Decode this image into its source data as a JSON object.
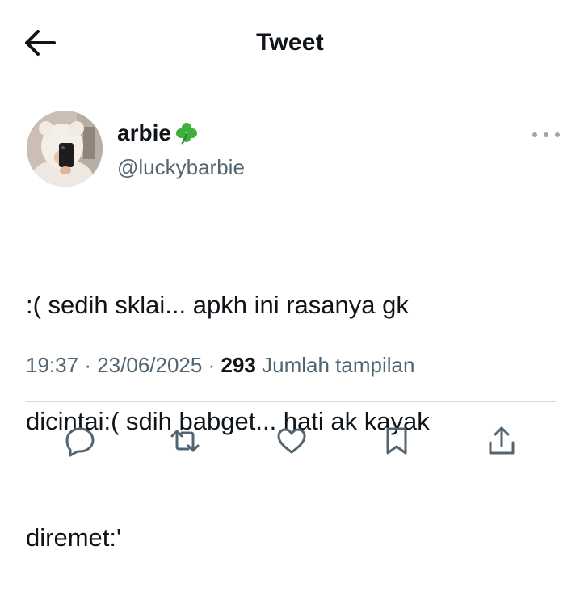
{
  "header": {
    "title": "Tweet",
    "back_icon": "arrow-left-icon"
  },
  "author": {
    "display_name": "arbie",
    "emoji": "🍀",
    "handle": "@luckybarbie",
    "avatar_icon": "avatar-photo",
    "more_icon": "more-horizontal-icon"
  },
  "tweet": {
    "lines": [
      ":( sedih sklai... apkh ini rasanya gk",
      "dicintai:( sdih babget... hati ak kayak",
      "diremet:'"
    ],
    "time": "19:37",
    "sep1": "·",
    "date": "23/06/2025",
    "sep2": "·",
    "views_count": "293",
    "views_label": "Jumlah tampilan"
  },
  "actions": [
    {
      "icon": "reply-icon"
    },
    {
      "icon": "retweet-icon"
    },
    {
      "icon": "like-icon"
    },
    {
      "icon": "bookmark-icon"
    },
    {
      "icon": "share-icon"
    }
  ],
  "colors": {
    "text": "#0f1419",
    "secondary": "#536471",
    "divider": "#d5dbe0",
    "clover": "#3fae3f"
  }
}
